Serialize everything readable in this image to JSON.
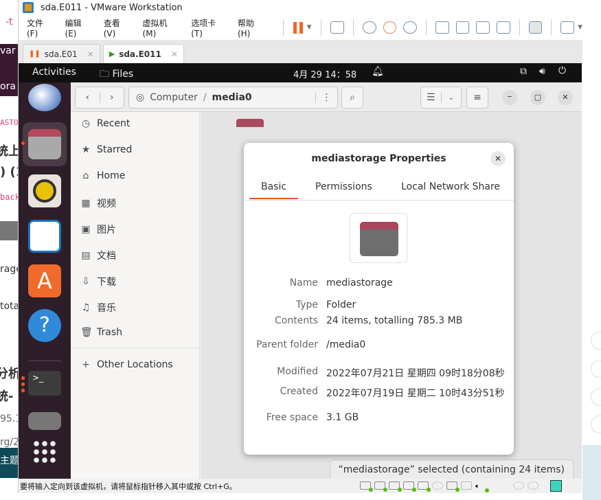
{
  "background_left": {
    "fragments": [
      "-t",
      "var",
      "ora",
      "ASTO",
      "统上",
      ") (1",
      "back",
      "rage",
      "tota",
      "分析",
      "统-",
      "95.1",
      "rg/2",
      "主题"
    ]
  },
  "vmware": {
    "title": "sda.E011 - VMware Workstation",
    "menu": [
      "文件(F)",
      "编辑(E)",
      "查看(V)",
      "虚拟机(M)",
      "选项卡(T)",
      "帮助(H)"
    ],
    "tabs": [
      {
        "label": "sda.E01",
        "state": "paused"
      },
      {
        "label": "sda.E011",
        "state": "running",
        "active": true
      }
    ],
    "status_text": "要将输入定向到该虚拟机，请将鼠标指针移入其中或按 Ctrl+G。",
    "pause_color": "#f26522"
  },
  "ubuntu": {
    "activities": "Activities",
    "app_menu": "Files",
    "clock": "4月 29  14：58",
    "dock": [
      "thunderbird",
      "files",
      "rhythmbox",
      "libreoffice-writer",
      "app-center",
      "help",
      "terminal",
      "removable-drive",
      "show-apps"
    ]
  },
  "files": {
    "path": [
      "Computer",
      "media0"
    ],
    "sidebar": [
      {
        "icon": "clock-icon",
        "label": "Recent"
      },
      {
        "icon": "star-icon",
        "label": "Starred"
      },
      {
        "icon": "home-icon",
        "label": "Home"
      },
      {
        "icon": "video-icon",
        "label": "视频"
      },
      {
        "icon": "image-icon",
        "label": "图片"
      },
      {
        "icon": "document-icon",
        "label": "文档"
      },
      {
        "icon": "download-icon",
        "label": "下载"
      },
      {
        "icon": "music-icon",
        "label": "音乐"
      },
      {
        "icon": "trash-icon",
        "label": "Trash"
      },
      {
        "icon": "plus-icon",
        "label": "Other Locations"
      }
    ],
    "status": "“mediastorage” selected  (containing 24 items)"
  },
  "dialog": {
    "title": "mediastorage Properties",
    "tabs": [
      "Basic",
      "Permissions",
      "Local Network Share"
    ],
    "active_tab": "Basic",
    "fields": [
      {
        "key": "Name",
        "value": "mediastorage"
      },
      {
        "key": "Type",
        "value": "Folder"
      },
      {
        "key": "Contents",
        "value": "24 items, totalling 785.3 MB"
      },
      {
        "key": "Parent folder",
        "value": "/media0"
      },
      {
        "key": "Modified",
        "value": "2022年07月21日 星期四 09时18分08秒"
      },
      {
        "key": "Created",
        "value": "2022年07月19日 星期二 10时43分51秒"
      },
      {
        "key": "Free space",
        "value": "3.1 GB"
      }
    ],
    "accent": "#e95420"
  }
}
